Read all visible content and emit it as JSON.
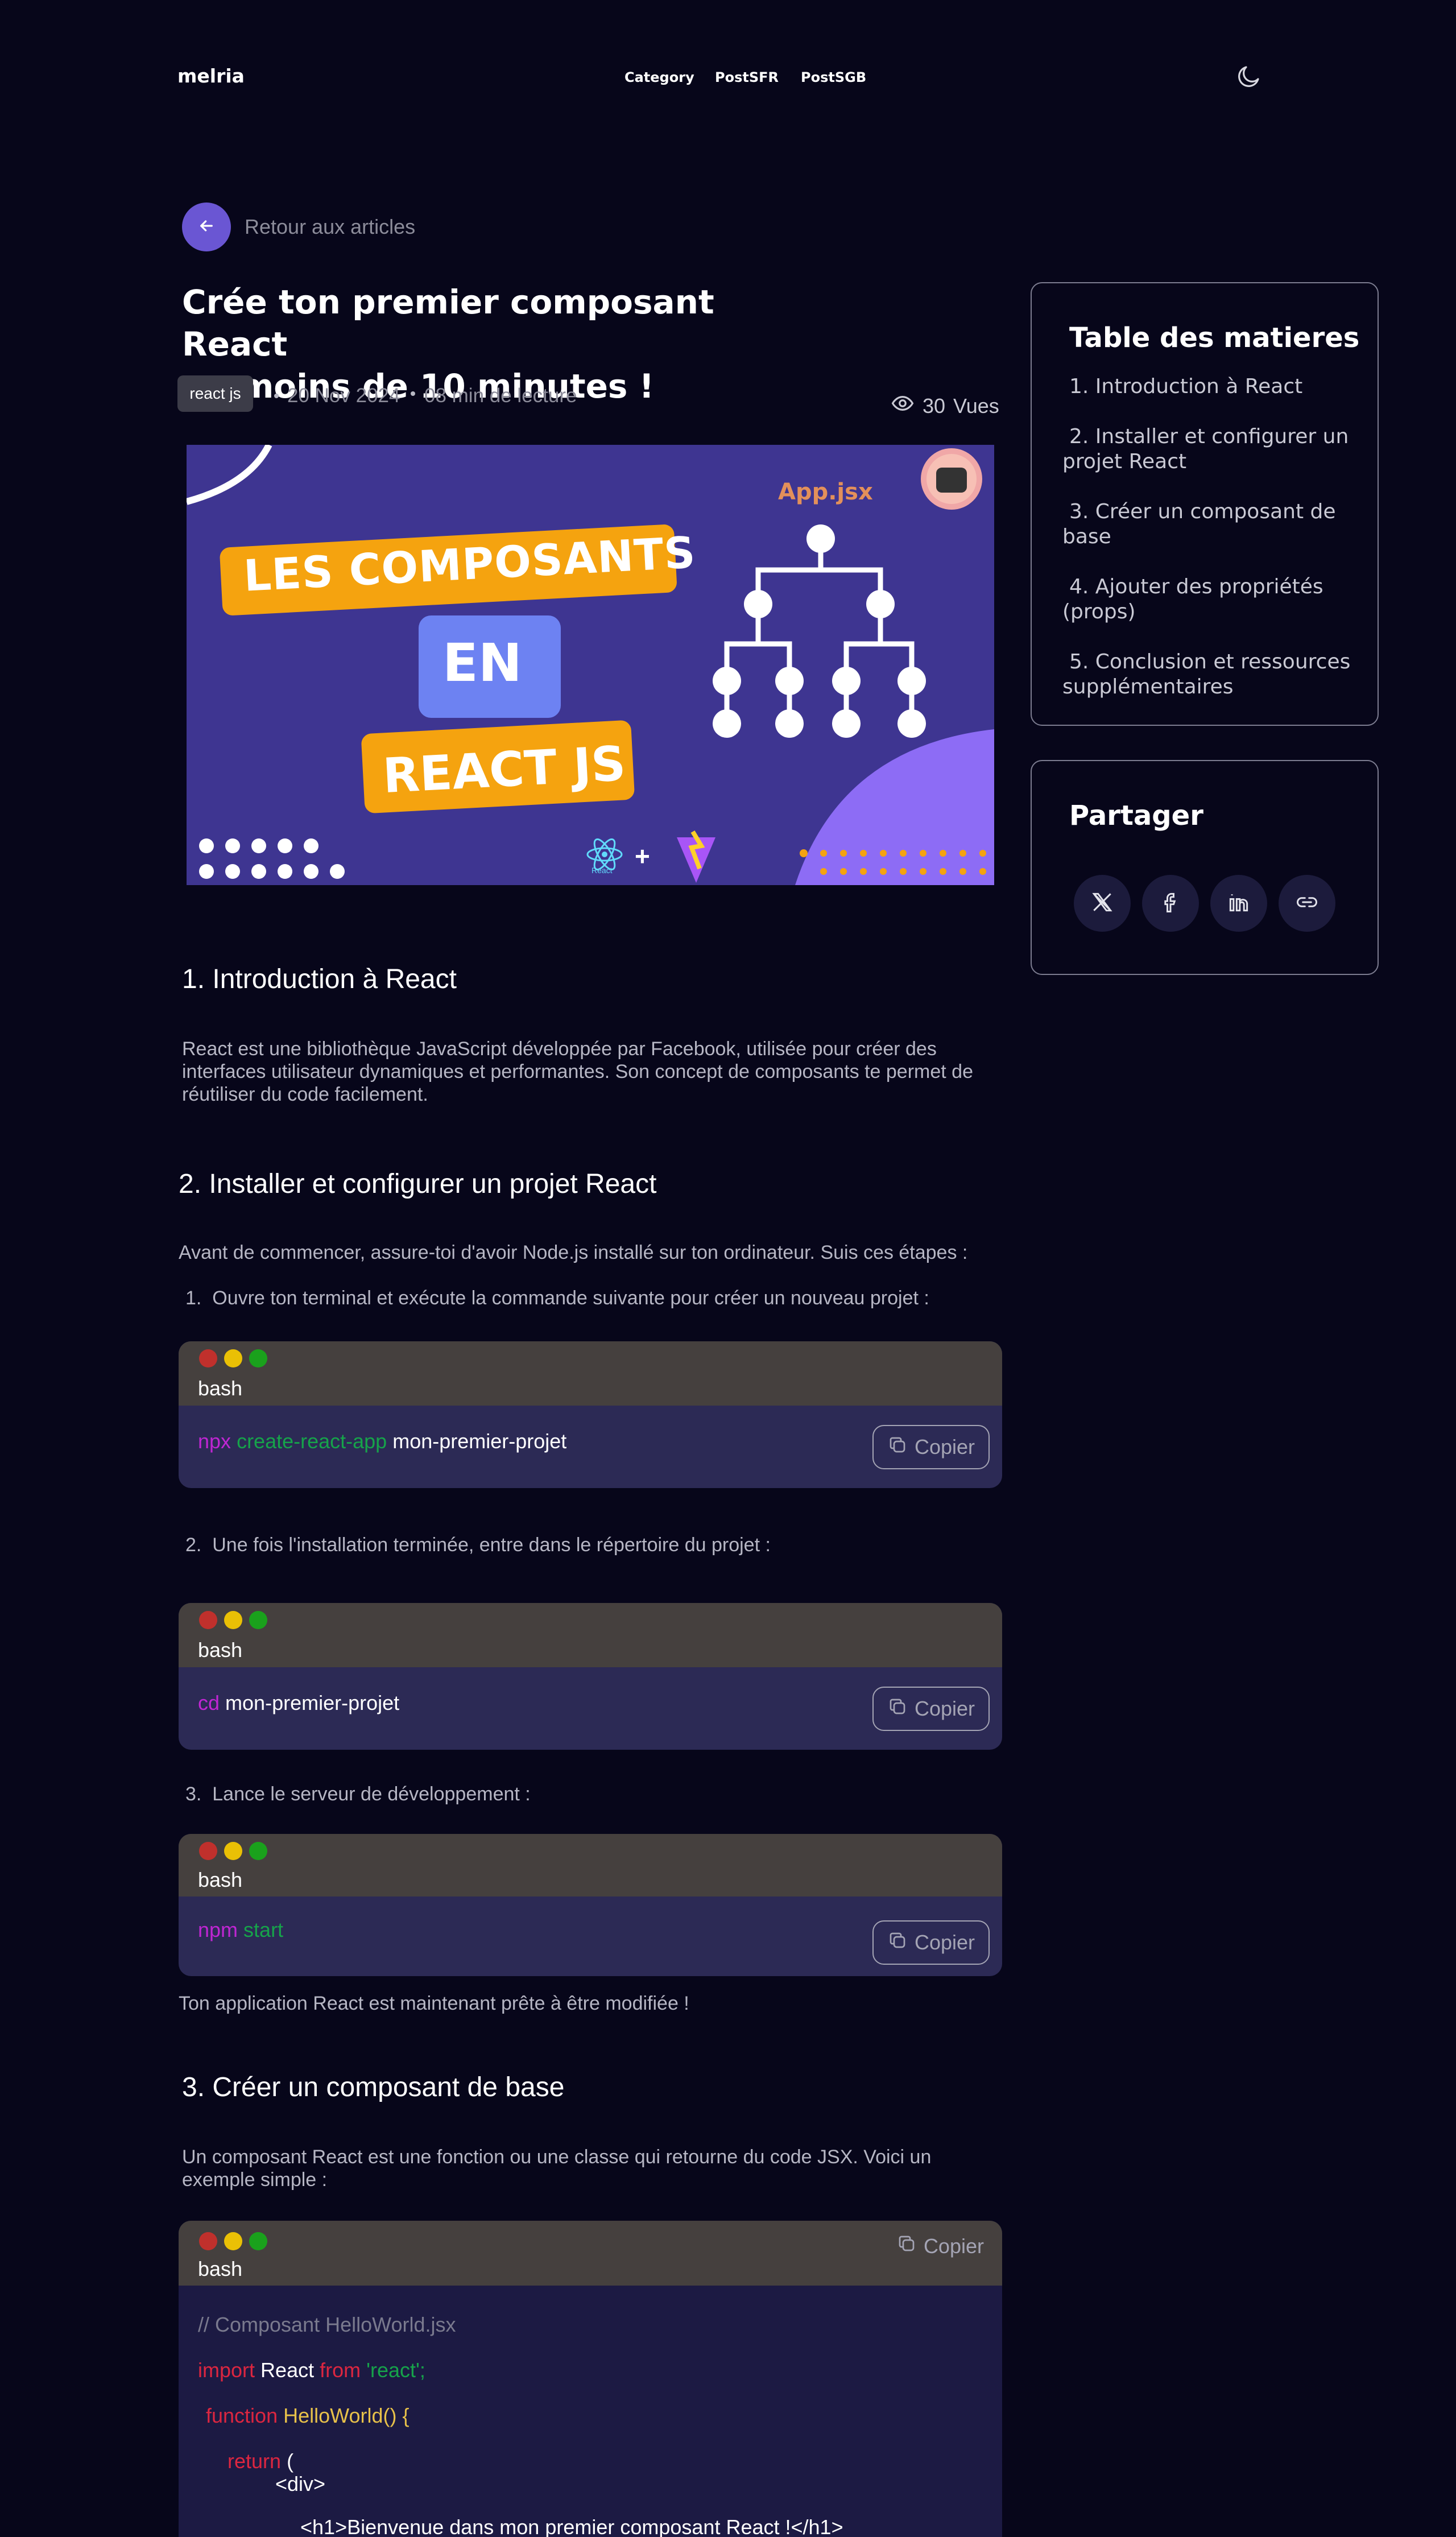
{
  "nav": {
    "logo": "melria",
    "links": [
      "Category",
      "PostSFR",
      "PostSGB"
    ],
    "theme_icon": "moon-icon"
  },
  "back": {
    "label": "Retour aux articles",
    "icon": "arrow-left-icon"
  },
  "article": {
    "title_line1": "Crée ton premier composant React",
    "title_line2": "en moins de 10 minutes !",
    "tag": "react js",
    "date": "20 Nov 2024",
    "read_time": "08 min de lecture",
    "views": "30",
    "views_label": "Vues"
  },
  "hero": {
    "filename": "App.jsx",
    "line1": "LES COMPOSANTS",
    "line2": "EN",
    "line3": "REACT JS",
    "react_caption": "React",
    "plus": "+"
  },
  "sections": {
    "s1": {
      "heading": "1. Introduction à React",
      "text": "React est une bibliothèque JavaScript développée par Facebook, utilisée pour créer des interfaces utilisateur dynamiques et performantes. Son concept de composants te permet de réutiliser du code facilement."
    },
    "s2": {
      "heading": "2. Installer et configurer un projet React",
      "intro": "Avant de commencer, assure-toi d'avoir Node.js installé sur ton ordinateur. Suis ces étapes :",
      "step1": "Ouvre ton terminal et exécute la commande suivante pour créer un nouveau projet :",
      "step2": "Une fois l'installation terminée, entre dans le répertoire du projet :",
      "step3": "Lance le serveur de développement :",
      "outro": "Ton application React est maintenant prête à être modifiée !"
    },
    "s3": {
      "heading": "3. Créer un composant de base",
      "text": "Un composant React est une fonction ou une classe qui retourne du code JSX. Voici un exemple simple :"
    }
  },
  "code_blocks": {
    "lang": "bash",
    "copy_label": "Copier",
    "b1": {
      "cmd": "npx",
      "sub": "create-react-app",
      "arg": "mon-premier-projet"
    },
    "b2": {
      "cmd": "cd",
      "arg": "mon-premier-projet"
    },
    "b3": {
      "cmd": "npm",
      "sub": "start"
    },
    "b4": {
      "comment": "// Composant HelloWorld.jsx",
      "import_kw": "import",
      "import_name": "React",
      "from_kw": "from",
      "module": "'react';",
      "function_kw": "function",
      "function_name": "HelloWorld() {",
      "return_kw": "return",
      "return_paren": "(",
      "div_open": "<div>",
      "h1_line": "<h1>Bienvenue dans mon premier composant React !</h1>"
    }
  },
  "toc": {
    "title": "Table des matieres",
    "items": [
      "1. Introduction à React",
      "2. Installer et configurer un projet React",
      "3. Créer un composant de base",
      "4. Ajouter des propriétés (props)",
      "5. Conclusion et ressources supplémentaires"
    ]
  },
  "share": {
    "title": "Partager",
    "buttons": [
      "x-icon",
      "facebook-icon",
      "linkedin-icon",
      "link-icon"
    ]
  },
  "colors": {
    "background": "#07061a",
    "accent": "#6a56d3",
    "code_body": "#2c2a55",
    "code_head": "#45403e"
  }
}
